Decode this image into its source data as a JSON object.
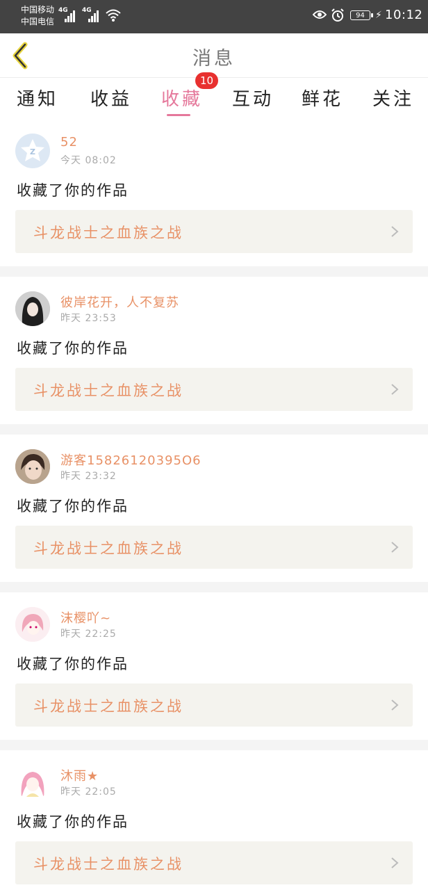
{
  "statusbar": {
    "carrier1": "中国移动",
    "carrier2": "中国电信",
    "net1": "4G",
    "net2": "4G",
    "battery": "94",
    "time": "10:12",
    "icons": [
      "signal-icon",
      "wifi-icon",
      "eye-icon",
      "alarm-icon",
      "battery-icon",
      "charging-icon"
    ]
  },
  "header": {
    "title": "消息",
    "back_icon": "chevron-left-icon"
  },
  "tabs": [
    {
      "label": "通知",
      "active": false
    },
    {
      "label": "收益",
      "active": false
    },
    {
      "label": "收藏",
      "active": true
    },
    {
      "label": "互动",
      "active": false
    },
    {
      "label": "鲜花",
      "active": false
    },
    {
      "label": "关注",
      "active": false
    }
  ],
  "badge": "10",
  "colors": {
    "accent": "#e5789b",
    "name": "#e89166",
    "badge": "#e8302f",
    "card": "#f4f3ee"
  },
  "messages": [
    {
      "name": "52",
      "time": "今天 08:02",
      "action": "收藏了你的作品",
      "work": "斗龙战士之血族之战",
      "avatar": "default-avatar-icon"
    },
    {
      "name": "彼岸花开，人不复苏",
      "time": "昨天 23:53",
      "action": "收藏了你的作品",
      "work": "斗龙战士之血族之战",
      "avatar": "user-avatar"
    },
    {
      "name": "游客15826120395O6",
      "time": "昨天 23:32",
      "action": "收藏了你的作品",
      "work": "斗龙战士之血族之战",
      "avatar": "user-avatar"
    },
    {
      "name": "沫樱吖~",
      "time": "昨天 22:25",
      "action": "收藏了你的作品",
      "work": "斗龙战士之血族之战",
      "avatar": "user-avatar"
    },
    {
      "name": "沐雨★",
      "time": "昨天 22:05",
      "action": "收藏了你的作品",
      "work": "斗龙战士之血族之战",
      "avatar": "user-avatar"
    }
  ]
}
